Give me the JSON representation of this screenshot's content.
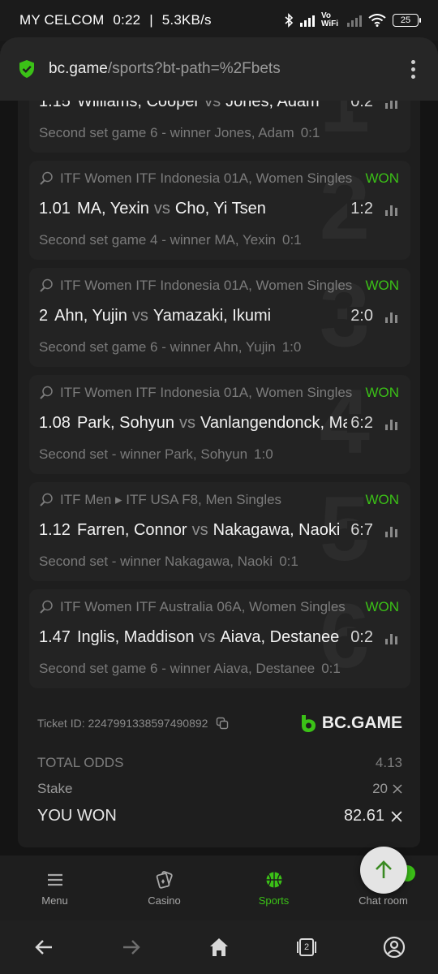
{
  "status_bar": {
    "carrier": "MY CELCOM",
    "time": "0:22",
    "speed": "5.3KB/s",
    "separator": "|",
    "volte": "Vo WiFi",
    "battery": "25"
  },
  "browser": {
    "host": "bc.game",
    "path": "/sports?bt-path=%2Fbets"
  },
  "bets": [
    {
      "index": "1",
      "league": "",
      "status": "",
      "odds": "1.15",
      "home": "Williams, Cooper",
      "vs": "vs",
      "away": "Jones, Adam",
      "score": "0:2",
      "market": "Second set game 6 - winner Jones, Adam",
      "market_result": "0:1"
    },
    {
      "index": "2",
      "league": "ITF Women ITF Indonesia 01A, Women Singles",
      "status": "WON",
      "odds": "1.01",
      "home": "MA, Yexin",
      "vs": "vs",
      "away": "Cho, Yi Tsen",
      "score": "1:2",
      "market": "Second set game 4 - winner MA, Yexin",
      "market_result": "0:1"
    },
    {
      "index": "3",
      "league": "ITF Women ITF Indonesia 01A, Women Singles",
      "status": "WON",
      "odds": "2",
      "home": "Ahn, Yujin",
      "vs": "vs",
      "away": "Yamazaki, Ikumi",
      "score": "2:0",
      "market": "Second set game 6 - winner Ahn, Yujin",
      "market_result": "1:0"
    },
    {
      "index": "4",
      "league": "ITF Women ITF Indonesia 01A, Women Singles",
      "status": "WON",
      "odds": "1.08",
      "home": "Park, Sohyun",
      "vs": "vs",
      "away": "Vanlangendonck, Magali",
      "score": "6:2",
      "market": "Second set - winner Park, Sohyun",
      "market_result": "1:0"
    },
    {
      "index": "5",
      "league": "ITF Men ▸ ITF USA F8, Men Singles",
      "status": "WON",
      "odds": "1.12",
      "home": "Farren, Connor",
      "vs": "vs",
      "away": "Nakagawa, Naoki",
      "score": "6:7",
      "market": "Second set - winner Nakagawa, Naoki",
      "market_result": "0:1"
    },
    {
      "index": "6",
      "league": "ITF Women ITF Australia 06A, Women Singles",
      "status": "WON",
      "odds": "1.47",
      "home": "Inglis, Maddison",
      "vs": "vs",
      "away": "Aiava, Destanee",
      "score": "0:2",
      "market": "Second set game 6 - winner Aiava, Destanee",
      "market_result": "0:1"
    }
  ],
  "ticket": {
    "id_label": "Ticket ID: 2247991338597490892",
    "brand": "BC.GAME",
    "total_odds_label": "TOTAL ODDS",
    "total_odds": "4.13",
    "stake_label": "Stake",
    "stake": "20",
    "won_label": "YOU WON",
    "won": "82.61"
  },
  "colors": {
    "accent_green": "#3bc117",
    "background": "#141414",
    "card": "#232323"
  },
  "bottom_nav": [
    {
      "label": "Menu",
      "icon": "hamburger-icon"
    },
    {
      "label": "Casino",
      "icon": "cards-icon"
    },
    {
      "label": "Sports",
      "icon": "basketball-icon"
    },
    {
      "label": "Chat room",
      "icon": "chat-icon"
    }
  ],
  "system_nav": {
    "tabs_count": "2"
  }
}
